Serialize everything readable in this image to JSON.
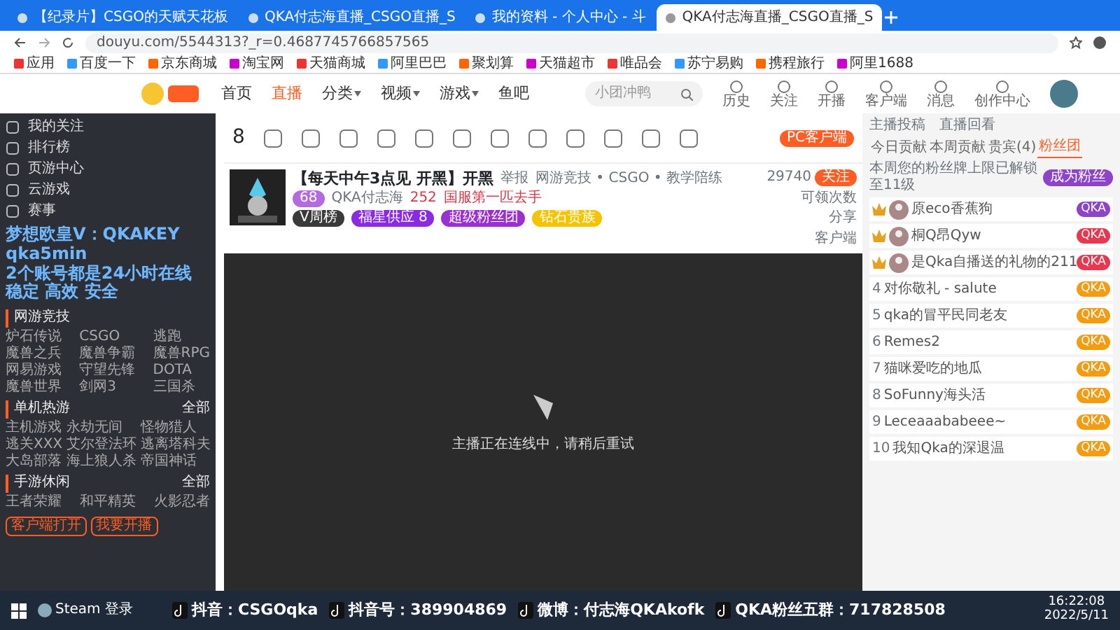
{
  "browser": {
    "tabs": [
      {
        "title": "【纪录片】CSGO的天赋天花板",
        "selected": false
      },
      {
        "title": "QKA付志海直播_CSGO直播_S",
        "selected": false
      },
      {
        "title": "我的资料 - 个人中心 - 斗",
        "selected": false
      },
      {
        "title": "QKA付志海直播_CSGO直播_S",
        "selected": true
      }
    ],
    "url": "douyu.com/5544313?_r=0.4687745766857565",
    "bookmarks": [
      "应用",
      "百度一下",
      "京东商城",
      "淘宝网",
      "天猫商城",
      "阿里巴巴",
      "聚划算",
      "天猫超市",
      "唯品会",
      "苏宁易购",
      "携程旅行",
      "阿里1688"
    ]
  },
  "header": {
    "nav": [
      {
        "label": "首页",
        "selected": false,
        "dropdown": false
      },
      {
        "label": "直播",
        "selected": true,
        "dropdown": false
      },
      {
        "label": "分类",
        "selected": false,
        "dropdown": true
      },
      {
        "label": "视频",
        "selected": false,
        "dropdown": true
      },
      {
        "label": "游戏",
        "selected": false,
        "dropdown": true
      },
      {
        "label": "鱼吧",
        "selected": false,
        "dropdown": false
      }
    ],
    "search_placeholder": "小团冲鸭",
    "actions": [
      "历史",
      "关注",
      "开播",
      "客户端",
      "消息",
      "创作中心"
    ]
  },
  "sidebar": {
    "links": [
      "我的关注",
      "排行榜",
      "页游中心",
      "云游戏",
      "赛事"
    ],
    "sections": [
      {
        "title": "网游竞技",
        "items": [
          "炉石传说",
          "CSGO",
          "逃跑",
          "魔兽之兵",
          "魔兽争霸",
          "魔兽RPG",
          "网易游戏",
          "守望先锋",
          "DOTA",
          "魔兽世界",
          "剑网3",
          "三国杀"
        ]
      },
      {
        "title": "单机热游",
        "more": "全部",
        "items": [
          "主机游戏",
          "永劫无间",
          "怪物猎人",
          "逃关XXX",
          "艾尔登法环",
          "逃离塔科夫",
          "大岛部落",
          "海上狼人杀",
          "帝国神话"
        ]
      },
      {
        "title": "手游休闲",
        "more": "全部",
        "items": [
          "王者荣耀",
          "和平精英",
          "火影忍者"
        ]
      }
    ],
    "buttons": [
      "客户端打开",
      "我要开播"
    ]
  },
  "toolbar": {
    "points": "8",
    "client_button": "PC客户端"
  },
  "streamer": {
    "title": "【每天中午3点见 开黑】开黑",
    "report": "举报",
    "category": "网游竞技 • CSGO • 教学陪练",
    "level": "68",
    "name": "QKA付志海",
    "heat": "252",
    "tag": "国服第一匹去手",
    "follow": "关注",
    "followers": "29740",
    "badges": [
      {
        "label": "V周榜",
        "color": "#3a3a3a"
      },
      {
        "label": "福星供应 8",
        "color": "#8a2be2"
      },
      {
        "label": "超级粉丝团",
        "color": "#9b30d0"
      },
      {
        "label": "钻石贵族",
        "color": "#f5c400"
      }
    ],
    "actions": [
      "可领次数",
      "分享",
      "客户端"
    ]
  },
  "video": {
    "message": "主播正在连线中，请稍后重试"
  },
  "ranking": {
    "links": [
      "主播投稿",
      "直播回看"
    ],
    "tabs": [
      {
        "label": "今日贡献",
        "selected": false
      },
      {
        "label": "本周贡献",
        "selected": false
      },
      {
        "label": "贵宾(4)",
        "selected": false
      },
      {
        "label": "粉丝团",
        "selected": true
      }
    ],
    "notice": "本周您的粉丝牌上限已解锁至11级",
    "join": "成为粉丝",
    "rows": [
      {
        "name": "原eco香蕉狗",
        "badge": "QKA",
        "color": "#8e44c8"
      },
      {
        "name": "桐Q昂Qyw",
        "badge": "QKA",
        "color": "#e8384f"
      },
      {
        "name": "是Qka自播送的礼物的211",
        "badge": "QKA",
        "color": "#e8384f"
      },
      {
        "rank": "4",
        "name": "对你敬礼 - salute",
        "badge": "QKA",
        "color": "#f39c12"
      },
      {
        "rank": "5",
        "name": "qka的冒平民同老友",
        "badge": "QKA",
        "color": "#f39c12"
      },
      {
        "rank": "6",
        "name": "Remes2",
        "badge": "QKA",
        "color": "#f39c12"
      },
      {
        "rank": "7",
        "name": "猫咪爱吃的地瓜",
        "badge": "QKA",
        "color": "#f39c12"
      },
      {
        "rank": "8",
        "name": "SoFunny海头活",
        "badge": "QKA",
        "color": "#f39c12"
      },
      {
        "rank": "9",
        "name": "Leceaaababeee~",
        "badge": "QKA",
        "color": "#f39c12"
      },
      {
        "rank": "10",
        "name": "我知Qka的深退温",
        "badge": "QKA",
        "color": "#f39c12"
      }
    ]
  },
  "overlay": {
    "promo": [
      "梦想欧皇V：QKAKEY",
      "qka5min",
      "2个账号都是24小时在线",
      "稳定 高效 安全"
    ],
    "socials": [
      "抖音：CSGOqka",
      "抖音号：389904869",
      "微博：付志海QKAkofk",
      "QKA粉丝五群：717828508"
    ]
  },
  "taskbar": {
    "apps": [
      "Steam 登录"
    ],
    "time": "16:22:08",
    "date": "2022/5/11"
  }
}
